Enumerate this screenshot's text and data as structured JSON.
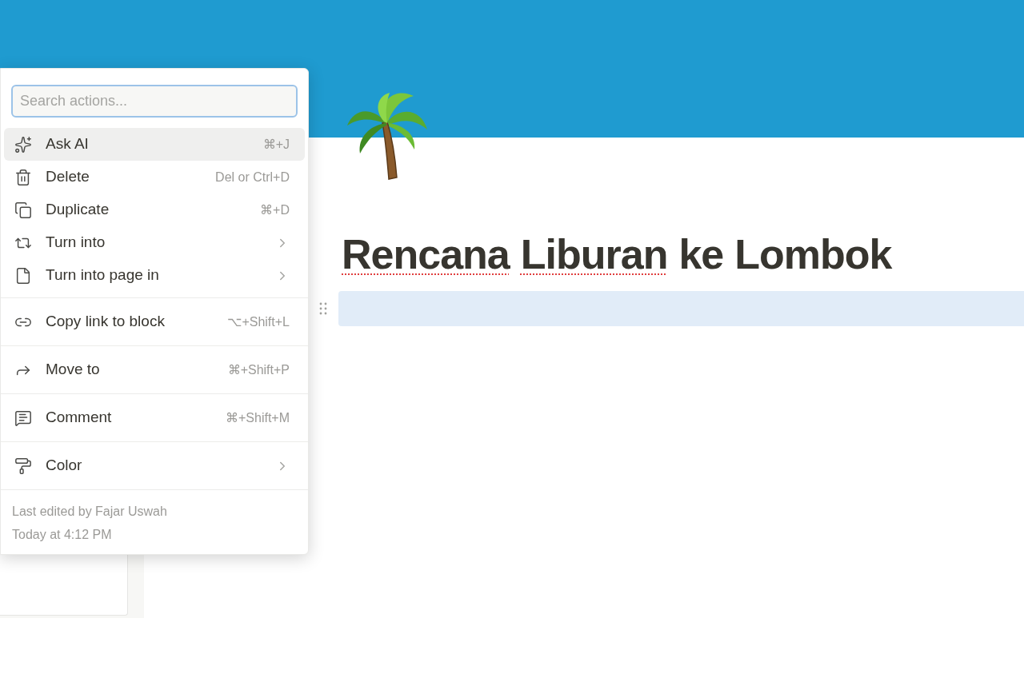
{
  "menu": {
    "search": {
      "placeholder": "Search actions..."
    },
    "groups": [
      [
        {
          "label": "Ask AI",
          "kind": "shortcut",
          "shortcut": "⌘+J",
          "selected": true
        },
        {
          "label": "Delete",
          "kind": "shortcut",
          "shortcut": "Del or Ctrl+D",
          "selected": false
        },
        {
          "label": "Duplicate",
          "kind": "shortcut",
          "shortcut": "⌘+D",
          "selected": false
        },
        {
          "label": "Turn into",
          "kind": "submenu",
          "selected": false
        },
        {
          "label": "Turn into page in",
          "kind": "submenu",
          "selected": false
        }
      ],
      [
        {
          "label": "Copy link to block",
          "kind": "shortcut",
          "shortcut": "⌥+Shift+L",
          "selected": false
        }
      ],
      [
        {
          "label": "Move to",
          "kind": "shortcut",
          "shortcut": "⌘+Shift+P",
          "selected": false
        }
      ],
      [
        {
          "label": "Comment",
          "kind": "shortcut",
          "shortcut": "⌘+Shift+M",
          "selected": false
        }
      ],
      [
        {
          "label": "Color",
          "kind": "submenu",
          "selected": false
        }
      ]
    ],
    "footer": [
      "Last edited by Fajar Uswah",
      "Today at 4:12 PM"
    ]
  },
  "page": {
    "title": [
      {
        "word": "Rencana",
        "misspelled": true
      },
      {
        "word": "Liburan",
        "misspelled": true
      },
      {
        "word": "ke",
        "misspelled": false
      },
      {
        "word": "Lombok",
        "misspelled": false
      }
    ],
    "block": {
      "selected": true
    }
  }
}
